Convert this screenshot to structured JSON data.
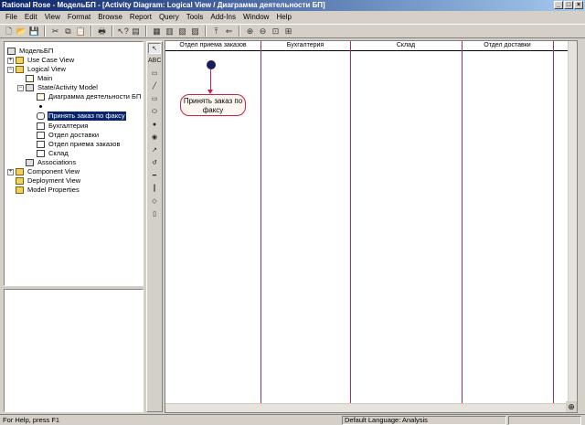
{
  "window": {
    "title": "Rational Rose - МодельБП - [Activity Diagram: Logical View / Диаграмма деятельности БП]",
    "min_label": "_",
    "max_label": "□",
    "close_label": "×"
  },
  "menu": [
    "File",
    "Edit",
    "View",
    "Format",
    "Browse",
    "Report",
    "Query",
    "Tools",
    "Add-Ins",
    "Window",
    "Help"
  ],
  "toolbar_icons": [
    "new-icon",
    "open-icon",
    "save-icon",
    "cut-icon",
    "copy-icon",
    "paste-icon",
    "print-icon",
    "context-help-icon",
    "view-doc-icon",
    "browse-class-icon",
    "browse-interaction-icon",
    "browse-component-icon",
    "browse-deployment-icon",
    "browse-parent-icon",
    "browse-previous-icon",
    "zoom-in-icon",
    "zoom-out-icon",
    "fit-window-icon",
    "undo-fit-icon"
  ],
  "tree": [
    {
      "label": "МодельБП",
      "level": 0,
      "icon": "model",
      "expander": ""
    },
    {
      "label": "Use Case View",
      "level": 1,
      "icon": "folder",
      "expander": "+"
    },
    {
      "label": "Logical View",
      "level": 1,
      "icon": "folder",
      "expander": "−"
    },
    {
      "label": "Main",
      "level": 2,
      "icon": "diag",
      "expander": ""
    },
    {
      "label": "State/Activity Model",
      "level": 2,
      "icon": "pkg",
      "expander": "−"
    },
    {
      "label": "Диаграмма деятельности БП",
      "level": 3,
      "icon": "diag",
      "expander": ""
    },
    {
      "label": "",
      "level": 3,
      "icon": "dot",
      "expander": ""
    },
    {
      "label": "Принять заказ по факсу",
      "level": 3,
      "icon": "state",
      "expander": "",
      "selected": true
    },
    {
      "label": "Бухгалтерия",
      "level": 3,
      "icon": "doc",
      "expander": ""
    },
    {
      "label": "Отдел доставки",
      "level": 3,
      "icon": "doc",
      "expander": ""
    },
    {
      "label": "Отдел приема заказов",
      "level": 3,
      "icon": "doc",
      "expander": ""
    },
    {
      "label": "Склад",
      "level": 3,
      "icon": "doc",
      "expander": ""
    },
    {
      "label": "Associations",
      "level": 2,
      "icon": "pkg",
      "expander": ""
    },
    {
      "label": "Component View",
      "level": 1,
      "icon": "folder",
      "expander": "+"
    },
    {
      "label": "Deployment View",
      "level": 1,
      "icon": "folder",
      "expander": ""
    },
    {
      "label": "Model Properties",
      "level": 1,
      "icon": "folder",
      "expander": ""
    }
  ],
  "palette": [
    {
      "name": "selection-tool-icon",
      "glyph": "↖",
      "active": true
    },
    {
      "name": "text-box-icon",
      "glyph": "ABC"
    },
    {
      "name": "note-icon",
      "glyph": "▭"
    },
    {
      "name": "anchor-note-icon",
      "glyph": "╱"
    },
    {
      "name": "state-icon",
      "glyph": "▭"
    },
    {
      "name": "activity-icon",
      "glyph": "⬭"
    },
    {
      "name": "start-state-icon",
      "glyph": "●"
    },
    {
      "name": "end-state-icon",
      "glyph": "◉"
    },
    {
      "name": "state-transition-icon",
      "glyph": "↗"
    },
    {
      "name": "transition-to-self-icon",
      "glyph": "↺"
    },
    {
      "name": "horizontal-sync-icon",
      "glyph": "━"
    },
    {
      "name": "vertical-sync-icon",
      "glyph": "┃"
    },
    {
      "name": "decision-icon",
      "glyph": "◇"
    },
    {
      "name": "swimlane-icon",
      "glyph": "▯"
    }
  ],
  "swimlanes": [
    "Отдел приема заказов",
    "Бухгалтерия",
    "Склад",
    "Отдел доставки"
  ],
  "activity": {
    "label": "Принять заказ по факсу"
  },
  "status": {
    "help": "For Help, press F1",
    "language": "Default Language: Analysis"
  }
}
